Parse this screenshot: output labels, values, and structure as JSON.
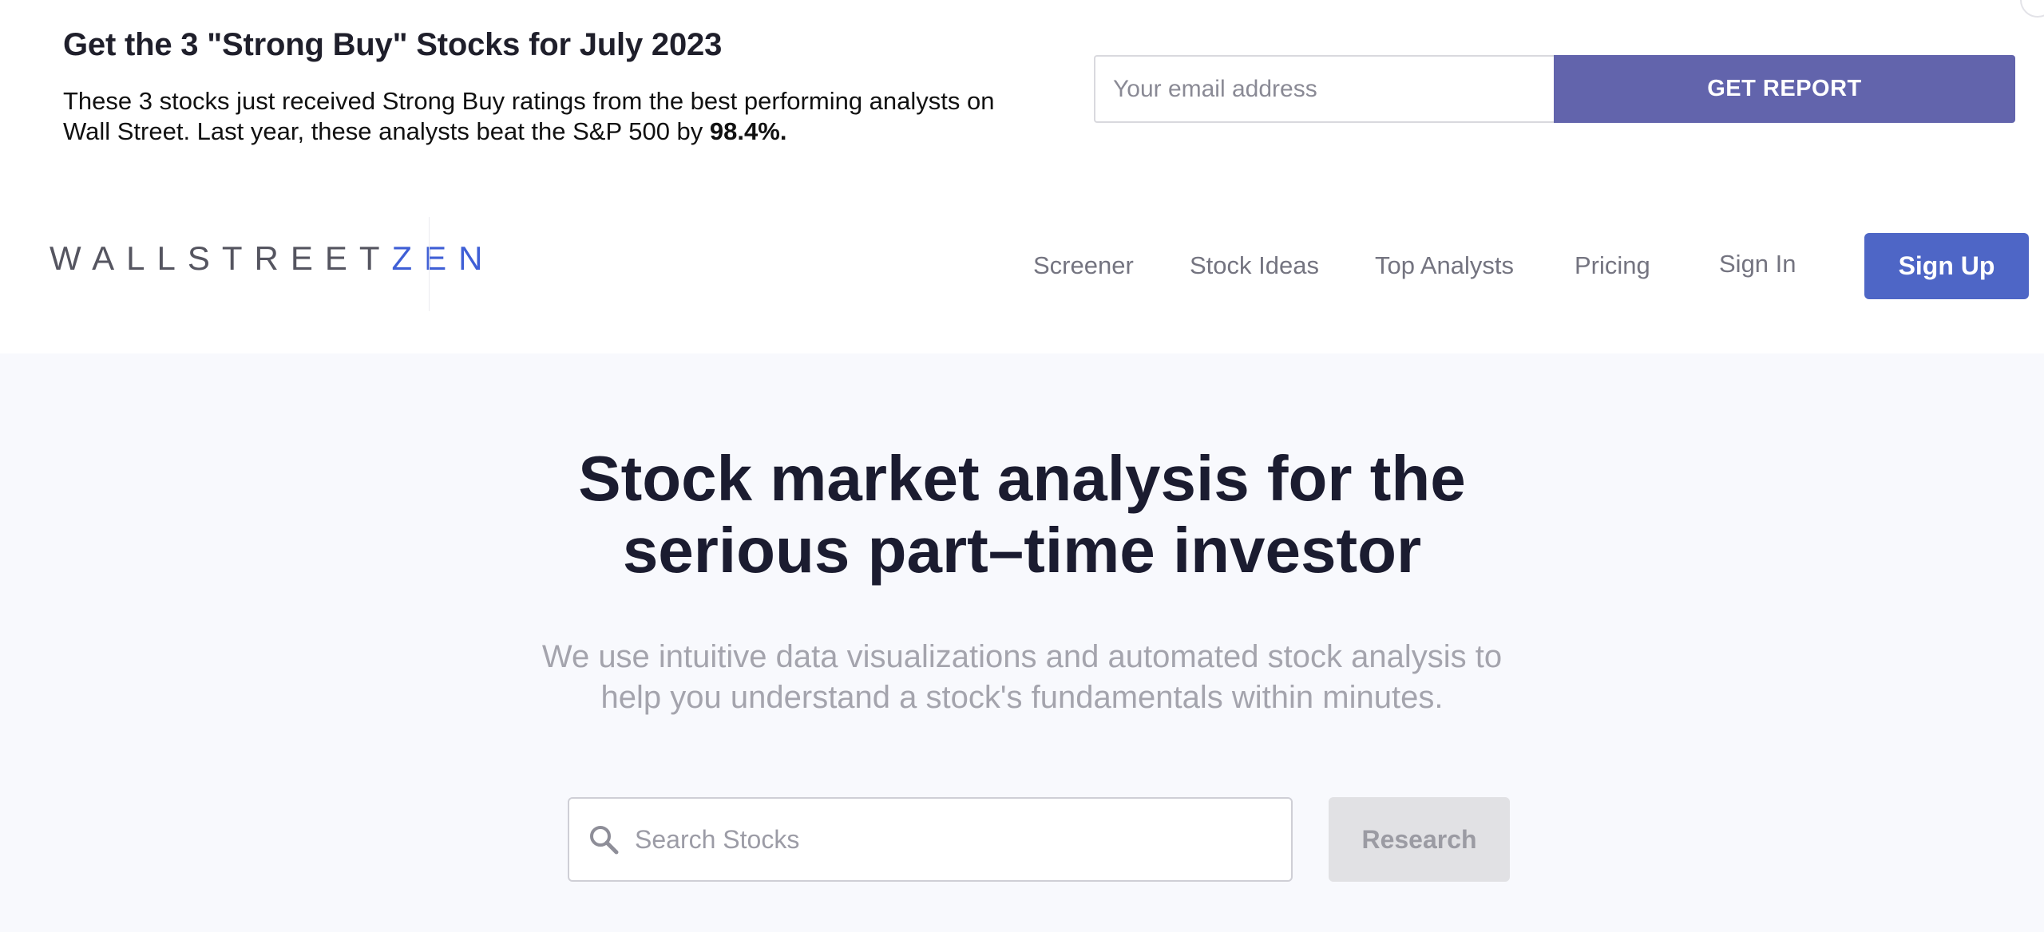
{
  "promo": {
    "title": "Get the 3 \"Strong Buy\" Stocks for July 2023",
    "text": "These 3 stocks just received Strong Buy ratings from the best performing analysts on Wall Street. Last year, these analysts beat the S&P 500 by",
    "highlight": "98.4%.",
    "email_placeholder": "Your email address",
    "button_label": "GET REPORT"
  },
  "nav": {
    "logo_main": "WALLSTREET",
    "logo_accent": "ZEN",
    "links": [
      "Screener",
      "Stock Ideas",
      "Top Analysts",
      "Pricing",
      "Sign In"
    ],
    "signup_label": "Sign Up"
  },
  "hero": {
    "title_line1": "Stock market analysis for the",
    "title_line2": "serious part–time investor",
    "subtitle_line1": "We use intuitive data visualizations and automated stock analysis to",
    "subtitle_line2": "help you understand a stock's fundamentals within minutes.",
    "search_placeholder": "Search Stocks",
    "research_label": "Research"
  },
  "colors": {
    "brand_blue": "#4e66c6",
    "promo_button": "#6264ac",
    "hero_background": "#f8f9fd"
  },
  "icons": {
    "search": "search-icon"
  }
}
